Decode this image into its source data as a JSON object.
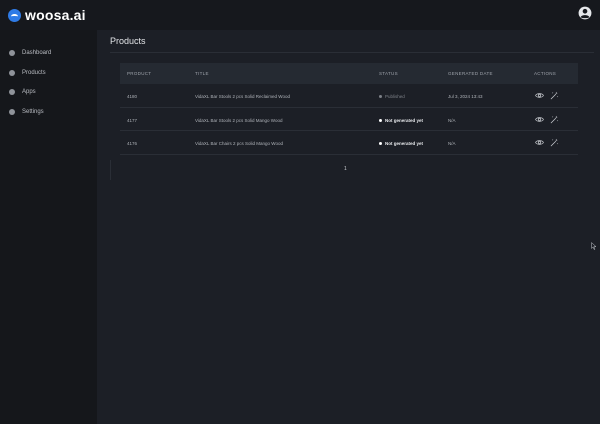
{
  "app": {
    "logo_text": "woosa.ai"
  },
  "sidebar": {
    "items": [
      {
        "label": "Dashboard",
        "icon": "dot-icon"
      },
      {
        "label": "Products",
        "icon": "dot-icon"
      },
      {
        "label": "Apps",
        "icon": "dot-icon"
      },
      {
        "label": "Settings",
        "icon": "dot-icon"
      }
    ]
  },
  "page": {
    "title": "Products"
  },
  "table": {
    "headers": [
      "PRODUCT",
      "TITLE",
      "STATUS",
      "GENERATED DATE",
      "ACTIONS"
    ],
    "rows": [
      {
        "product": "4180",
        "title": "VidaXL Bar Stools 2 pcs Solid Reclaimed Wood",
        "status": "Published",
        "date": "Jul 3, 2024 13:43"
      },
      {
        "product": "4177",
        "title": "VidaXL Bar Stools 2 pcs Solid Mango Wood",
        "status": "Not generated yet",
        "date": "N/A"
      },
      {
        "product": "4176",
        "title": "VidaXL Bar Chairs 2 pcs Solid Mango Wood",
        "status": "Not generated yet",
        "date": "N/A"
      }
    ]
  },
  "pagination": {
    "current": "1"
  },
  "colors": {
    "background": "#1c1f26",
    "sidebar": "#15171b",
    "header_row": "#252a32",
    "accent": "#2f7be6"
  }
}
